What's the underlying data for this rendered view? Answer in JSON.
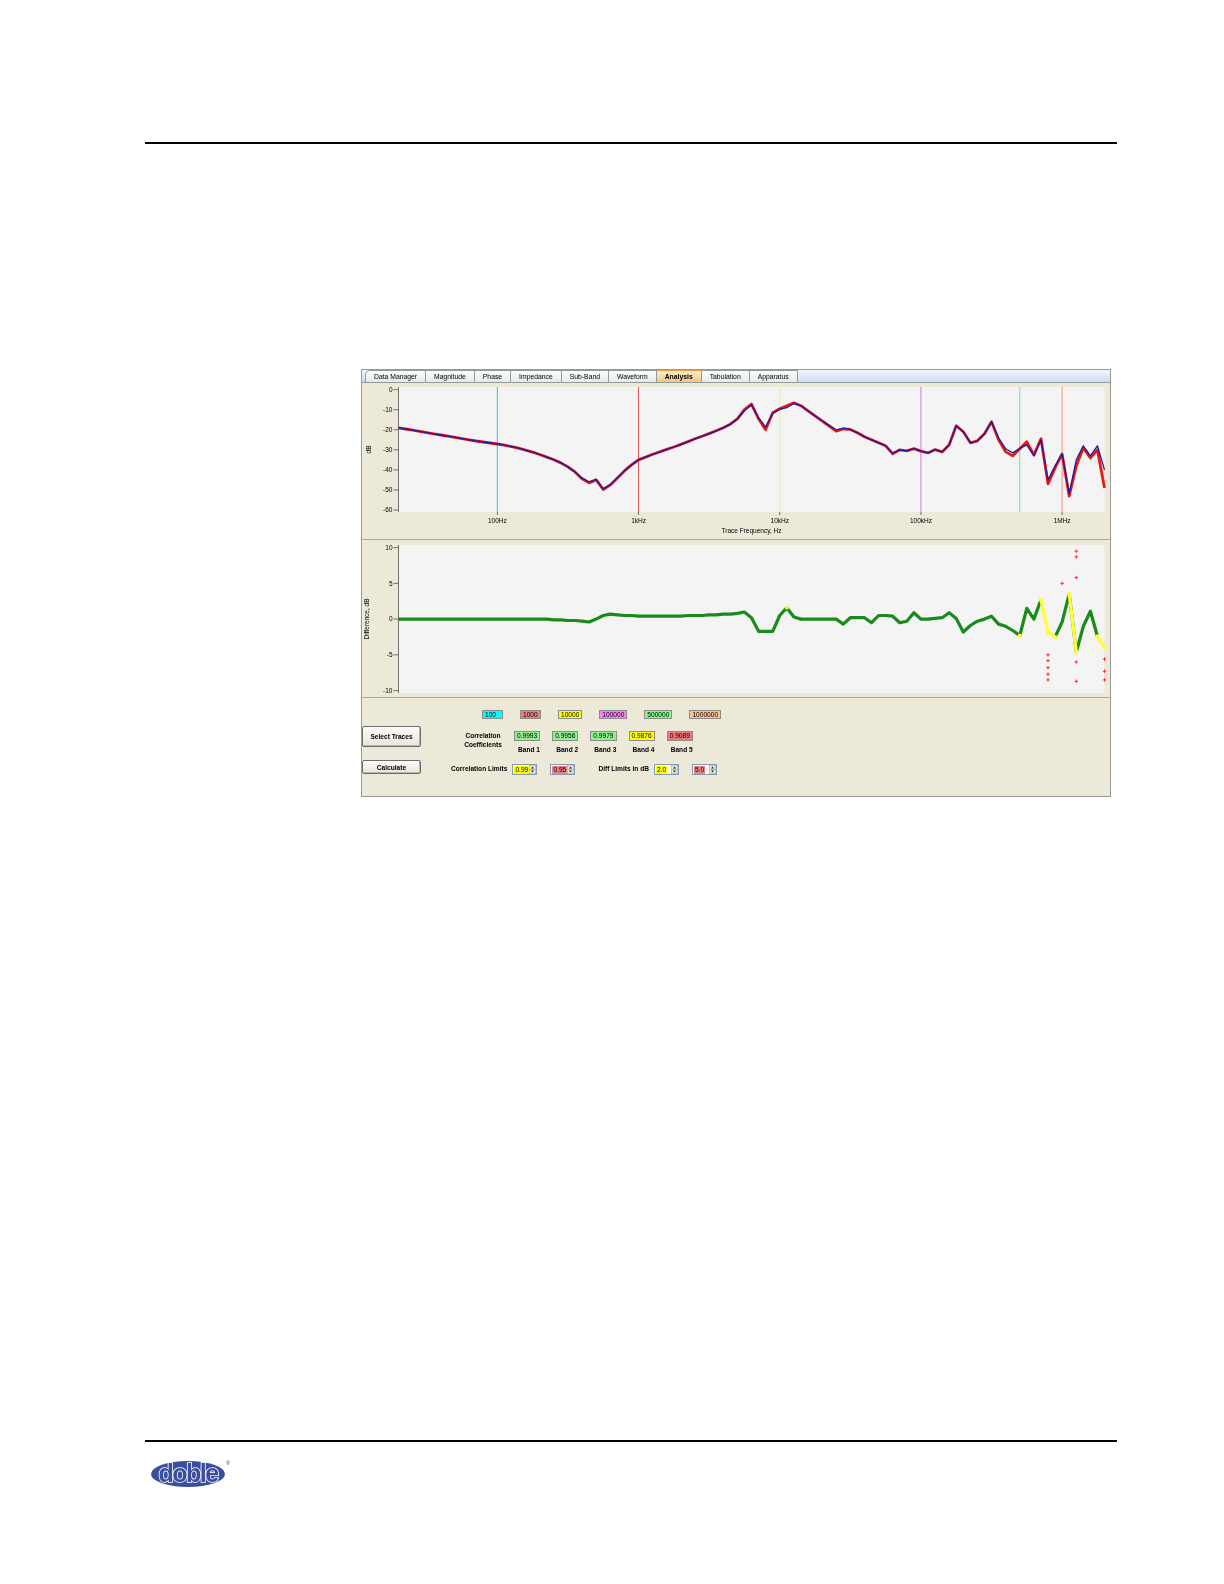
{
  "tabs": [
    {
      "label": "Data Manager",
      "selected": false
    },
    {
      "label": "Magnitude",
      "selected": false
    },
    {
      "label": "Phase",
      "selected": false
    },
    {
      "label": "Impedance",
      "selected": false
    },
    {
      "label": "Sub-Band",
      "selected": false
    },
    {
      "label": "Waveform",
      "selected": false
    },
    {
      "label": "Analysis",
      "selected": true
    },
    {
      "label": "Tabulation",
      "selected": false
    },
    {
      "label": "Apparatus",
      "selected": false
    }
  ],
  "magnitude_chart": {
    "chart_data": {
      "type": "line",
      "xlabel": "Trace Frequency, Hz",
      "ylabel": "dB",
      "categories": [
        null,
        null,
        null,
        null,
        null,
        null,
        null,
        null,
        null,
        null,
        null,
        null,
        null,
        null,
        "100Hz",
        null,
        null,
        null,
        null,
        null,
        null,
        null,
        null,
        null,
        null,
        null,
        null,
        null,
        null,
        null,
        null,
        null,
        null,
        null,
        "1kHz",
        null,
        null,
        null,
        null,
        null,
        null,
        null,
        null,
        null,
        null,
        null,
        null,
        null,
        null,
        null,
        null,
        null,
        null,
        null,
        "10kHz",
        null,
        null,
        null,
        null,
        null,
        null,
        null,
        null,
        null,
        null,
        null,
        null,
        null,
        null,
        null,
        null,
        null,
        null,
        null,
        "100kHz",
        null,
        null,
        null,
        null,
        null,
        null,
        null,
        null,
        null,
        null,
        null,
        null,
        null,
        null,
        null,
        null,
        null,
        null,
        null,
        "1MHz",
        null,
        null,
        null,
        null,
        null,
        null
      ],
      "series": [
        {
          "color": "#e81818",
          "values": [
            -19,
            -19.6,
            -20.2,
            -20.8,
            -21.4,
            -22,
            -22.6,
            -23.2,
            -23.8,
            -24.4,
            -25,
            -25.6,
            -26.1,
            -26.6,
            -27.1,
            -27.7,
            -28.4,
            -29.2,
            -30.1,
            -31.1,
            -32.3,
            -33.6,
            -34.9,
            -36.5,
            -38.5,
            -41,
            -44.5,
            -46.5,
            -45,
            -49.8,
            -47.5,
            -44,
            -40.5,
            -37.5,
            -35,
            -33.6,
            -32.2,
            -31,
            -29.8,
            -28.6,
            -27.3,
            -25.9,
            -24.5,
            -23.2,
            -21.9,
            -20.5,
            -19,
            -17.2,
            -14.5,
            -10,
            -7.2,
            -14.5,
            -20,
            -11.5,
            -9.5,
            -8,
            -6.6,
            -8,
            -10.5,
            -13,
            -15.5,
            -18.2,
            -20.7,
            -19.6,
            -19.8,
            -21.5,
            -23.5,
            -25,
            -26.5,
            -28,
            -32,
            -30,
            -30.5,
            -29.4,
            -30.6,
            -31.5,
            -29.9,
            -31,
            -27.5,
            -18,
            -21,
            -26.5,
            -25.5,
            -22,
            -16,
            -25,
            -31,
            -33,
            -29.5,
            -26,
            -32.5,
            -24.5,
            -47,
            -39,
            -32,
            -53,
            -38,
            -29,
            -34,
            -30,
            -49
          ]
        },
        {
          "color": "#1c1ca0",
          "values": [
            -19,
            -19.6,
            -20.2,
            -20.8,
            -21.4,
            -22,
            -22.6,
            -23.2,
            -23.8,
            -24.4,
            -25,
            -25.6,
            -26.1,
            -26.6,
            -27.1,
            -27.7,
            -28.4,
            -29.2,
            -30.1,
            -31.1,
            -32.3,
            -33.6,
            -34.9,
            -36.5,
            -38.5,
            -41,
            -44,
            -46,
            -44.7,
            -49.5,
            -47.5,
            -44,
            -40.5,
            -37.5,
            -35,
            -33.6,
            -32.2,
            -31,
            -29.8,
            -28.6,
            -27.3,
            -25.9,
            -24.5,
            -23.2,
            -21.9,
            -20.5,
            -19,
            -17.2,
            -14.5,
            -10.5,
            -7.5,
            -14,
            -18.5,
            -12,
            -9.8,
            -9,
            -6.8,
            -8,
            -10.5,
            -13,
            -15.5,
            -17.8,
            -20,
            -19.2,
            -19.8,
            -21.5,
            -23.5,
            -25,
            -26.5,
            -28,
            -31.5,
            -30,
            -30.5,
            -29.4,
            -30.6,
            -31.5,
            -29.9,
            -31,
            -27.5,
            -18,
            -21,
            -26.5,
            -25.5,
            -22,
            -16,
            -24,
            -29.5,
            -31.5,
            -29.3,
            -27.5,
            -33,
            -25,
            -45,
            -38,
            -32,
            -52,
            -35,
            -28,
            -33,
            -28,
            -40
          ]
        }
      ],
      "ylim": [
        -60,
        0
      ],
      "yticks": [
        0,
        -10,
        -20,
        -30,
        -40,
        -50,
        -60
      ],
      "ref_lines": [
        {
          "axis": "x",
          "value": "100Hz",
          "color": "#20c8f0"
        },
        {
          "axis": "x",
          "value": "1kHz",
          "color": "#e05a5a"
        },
        {
          "axis": "x",
          "value": "10kHz",
          "color": "#f0f070"
        },
        {
          "axis": "x",
          "value": "100kHz",
          "color": "#e070e0"
        },
        {
          "axis": "x",
          "value": "1MHz",
          "color": "#f09878"
        }
      ]
    }
  },
  "difference_chart": {
    "chart_data": {
      "type": "line",
      "ylabel": "Difference, dB",
      "categories": [
        null,
        null,
        null,
        null,
        null,
        null,
        null,
        null,
        null,
        null,
        null,
        null,
        null,
        null,
        null,
        null,
        null,
        null,
        null,
        null,
        null,
        null,
        null,
        null,
        null,
        null,
        null,
        null,
        null,
        null,
        null,
        null,
        null,
        null,
        null,
        null,
        null,
        null,
        null,
        null,
        null,
        null,
        null,
        null,
        null,
        null,
        null,
        null,
        null,
        null,
        null,
        null,
        null,
        null,
        null,
        null,
        null,
        null,
        null,
        null,
        null,
        null,
        null,
        null,
        null,
        null,
        null,
        null,
        null,
        null,
        null,
        null,
        null,
        null,
        null,
        null,
        null,
        null,
        null,
        null,
        null,
        null,
        null,
        null,
        null,
        null,
        null,
        null,
        null,
        null,
        null,
        null,
        null,
        null,
        null,
        null,
        null,
        null,
        null,
        null,
        null
      ],
      "series": [
        {
          "color": "#1a8a1a",
          "values": [
            0,
            0,
            0,
            0,
            0,
            0,
            0,
            0,
            0,
            0,
            0,
            0,
            0,
            0,
            0,
            0,
            0,
            0,
            0,
            0,
            0,
            0,
            -0.1,
            -0.1,
            -0.2,
            -0.2,
            -0.3,
            -0.4,
            0,
            0.5,
            0.7,
            0.6,
            0.5,
            0.5,
            0.4,
            0.4,
            0.4,
            0.4,
            0.4,
            0.4,
            0.4,
            0.5,
            0.5,
            0.5,
            0.6,
            0.6,
            0.7,
            0.7,
            0.8,
            1,
            0.2,
            -1.7,
            -1.7,
            -1.7,
            0.5,
            1.6,
            0.3,
            0,
            0,
            0,
            0,
            0,
            0,
            -0.7,
            0.2,
            0.2,
            0.2,
            -0.5,
            0.5,
            0.5,
            0.4,
            -0.5,
            -0.3,
            0.9,
            0,
            0,
            0.1,
            0.2,
            0.9,
            0.1,
            -1.8,
            -0.9,
            -0.3,
            0,
            0.4,
            -0.7,
            -1,
            -1.6,
            -2.3,
            1.5,
            0,
            2.7,
            null,
            -2.5,
            -0.4,
            3.5,
            -4.6,
            -1,
            1.1,
            -2.4,
            null
          ]
        },
        {
          "color": "#ffff33",
          "marker": "square",
          "values": [
            null,
            null,
            null,
            null,
            null,
            null,
            null,
            null,
            null,
            null,
            null,
            null,
            null,
            null,
            null,
            null,
            null,
            null,
            null,
            null,
            null,
            null,
            null,
            null,
            null,
            null,
            null,
            null,
            null,
            null,
            null,
            null,
            null,
            null,
            null,
            null,
            null,
            null,
            null,
            null,
            null,
            null,
            null,
            null,
            null,
            null,
            null,
            null,
            null,
            null,
            null,
            null,
            null,
            null,
            null,
            1.6,
            null,
            null,
            null,
            null,
            null,
            null,
            null,
            null,
            null,
            null,
            null,
            null,
            null,
            null,
            null,
            null,
            null,
            null,
            null,
            null,
            null,
            null,
            null,
            null,
            null,
            null,
            null,
            null,
            null,
            null,
            null,
            null,
            -2.3,
            null,
            null,
            2.7,
            -1.9,
            -2.5,
            null,
            3.5,
            -4.6,
            null,
            null,
            -2.4,
            -4
          ]
        },
        {
          "color": "#ff2020",
          "marker": "plus",
          "values": [
            null,
            null,
            null,
            null,
            null,
            null,
            null,
            null,
            null,
            null,
            null,
            null,
            null,
            null,
            null,
            null,
            null,
            null,
            null,
            null,
            null,
            null,
            null,
            null,
            null,
            null,
            null,
            null,
            null,
            null,
            null,
            null,
            null,
            null,
            null,
            null,
            null,
            null,
            null,
            null,
            null,
            null,
            null,
            null,
            null,
            null,
            null,
            null,
            null,
            null,
            null,
            null,
            null,
            null,
            null,
            null,
            null,
            null,
            null,
            null,
            null,
            null,
            null,
            null,
            null,
            null,
            null,
            null,
            null,
            null,
            null,
            null,
            null,
            null,
            null,
            null,
            null,
            null,
            null,
            null,
            null,
            null,
            null,
            null,
            null,
            null,
            null,
            null,
            null,
            null,
            null,
            null,
            -5,
            null,
            5,
            null,
            9.5,
            null,
            null,
            null,
            -5.6
          ]
        },
        {
          "color": "#ff2020",
          "marker": "plus",
          "values": [
            null,
            null,
            null,
            null,
            null,
            null,
            null,
            null,
            null,
            null,
            null,
            null,
            null,
            null,
            null,
            null,
            null,
            null,
            null,
            null,
            null,
            null,
            null,
            null,
            null,
            null,
            null,
            null,
            null,
            null,
            null,
            null,
            null,
            null,
            null,
            null,
            null,
            null,
            null,
            null,
            null,
            null,
            null,
            null,
            null,
            null,
            null,
            null,
            null,
            null,
            null,
            null,
            null,
            null,
            null,
            null,
            null,
            null,
            null,
            null,
            null,
            null,
            null,
            null,
            null,
            null,
            null,
            null,
            null,
            null,
            null,
            null,
            null,
            null,
            null,
            null,
            null,
            null,
            null,
            null,
            null,
            null,
            null,
            null,
            null,
            null,
            null,
            null,
            null,
            null,
            null,
            null,
            -5.8,
            null,
            null,
            null,
            8.7,
            null,
            null,
            null,
            -7.3
          ]
        },
        {
          "color": "#ff2020",
          "marker": "plus",
          "values": [
            null,
            null,
            null,
            null,
            null,
            null,
            null,
            null,
            null,
            null,
            null,
            null,
            null,
            null,
            null,
            null,
            null,
            null,
            null,
            null,
            null,
            null,
            null,
            null,
            null,
            null,
            null,
            null,
            null,
            null,
            null,
            null,
            null,
            null,
            null,
            null,
            null,
            null,
            null,
            null,
            null,
            null,
            null,
            null,
            null,
            null,
            null,
            null,
            null,
            null,
            null,
            null,
            null,
            null,
            null,
            null,
            null,
            null,
            null,
            null,
            null,
            null,
            null,
            null,
            null,
            null,
            null,
            null,
            null,
            null,
            null,
            null,
            null,
            null,
            null,
            null,
            null,
            null,
            null,
            null,
            null,
            null,
            null,
            null,
            null,
            null,
            null,
            null,
            null,
            null,
            null,
            null,
            -6.8,
            null,
            null,
            null,
            5.8,
            null,
            null,
            null,
            -8.5
          ]
        },
        {
          "color": "#ff2020",
          "marker": "plus",
          "values": [
            null,
            null,
            null,
            null,
            null,
            null,
            null,
            null,
            null,
            null,
            null,
            null,
            null,
            null,
            null,
            null,
            null,
            null,
            null,
            null,
            null,
            null,
            null,
            null,
            null,
            null,
            null,
            null,
            null,
            null,
            null,
            null,
            null,
            null,
            null,
            null,
            null,
            null,
            null,
            null,
            null,
            null,
            null,
            null,
            null,
            null,
            null,
            null,
            null,
            null,
            null,
            null,
            null,
            null,
            null,
            null,
            null,
            null,
            null,
            null,
            null,
            null,
            null,
            null,
            null,
            null,
            null,
            null,
            null,
            null,
            null,
            null,
            null,
            null,
            null,
            null,
            null,
            null,
            null,
            null,
            null,
            null,
            null,
            null,
            null,
            null,
            null,
            null,
            null,
            null,
            null,
            null,
            -7.7,
            null,
            null,
            null,
            -6,
            null,
            null,
            null,
            null
          ]
        },
        {
          "color": "#ff2020",
          "marker": "plus",
          "values": [
            null,
            null,
            null,
            null,
            null,
            null,
            null,
            null,
            null,
            null,
            null,
            null,
            null,
            null,
            null,
            null,
            null,
            null,
            null,
            null,
            null,
            null,
            null,
            null,
            null,
            null,
            null,
            null,
            null,
            null,
            null,
            null,
            null,
            null,
            null,
            null,
            null,
            null,
            null,
            null,
            null,
            null,
            null,
            null,
            null,
            null,
            null,
            null,
            null,
            null,
            null,
            null,
            null,
            null,
            null,
            null,
            null,
            null,
            null,
            null,
            null,
            null,
            null,
            null,
            null,
            null,
            null,
            null,
            null,
            null,
            null,
            null,
            null,
            null,
            null,
            null,
            null,
            null,
            null,
            null,
            null,
            null,
            null,
            null,
            null,
            null,
            null,
            null,
            null,
            null,
            null,
            null,
            -8.5,
            null,
            null,
            null,
            -8.7,
            null,
            null,
            null,
            null
          ]
        }
      ],
      "ylim": [
        -10,
        10
      ],
      "yticks": [
        10,
        5,
        0,
        -5,
        -10
      ]
    }
  },
  "band_limits": [
    {
      "value": "100",
      "color": "#00ffff"
    },
    {
      "value": "1000",
      "color": "#f08080"
    },
    {
      "value": "10000",
      "color": "#ffff00"
    },
    {
      "value": "100000",
      "color": "#ff80ff"
    },
    {
      "value": "500000",
      "color": "#80ff80"
    },
    {
      "value": "1000000",
      "color": "#ffc090"
    }
  ],
  "select_traces_button": {
    "label": "Select Traces"
  },
  "correlation_coefficients": {
    "label": "Correlation Coefficients",
    "items": [
      {
        "value": "0.9993",
        "color": "#90f090",
        "band": "Band 1"
      },
      {
        "value": "0.9956",
        "color": "#90f090",
        "band": "Band 2"
      },
      {
        "value": "0.9979",
        "color": "#90f090",
        "band": "Band 3"
      },
      {
        "value": "0.9876",
        "color": "#ffff00",
        "band": "Band 4"
      },
      {
        "value": "0.9089",
        "color": "#f07878",
        "band": "Band 5"
      }
    ]
  },
  "calculate_button": {
    "label": "Calculate"
  },
  "correlation_limits": {
    "label": "Correlation Limits",
    "fields": [
      {
        "value": "0.99",
        "color": "#ffff00"
      },
      {
        "value": "0.95",
        "color": "#f08080"
      }
    ]
  },
  "diff_limits": {
    "label": "Diff Limits in dB",
    "fields": [
      {
        "value": "2.0",
        "color": "#ffff00"
      },
      {
        "value": "5.0",
        "color": "#f08080"
      }
    ]
  },
  "footer": {
    "logo": "doble",
    "logo_mark": "®"
  }
}
